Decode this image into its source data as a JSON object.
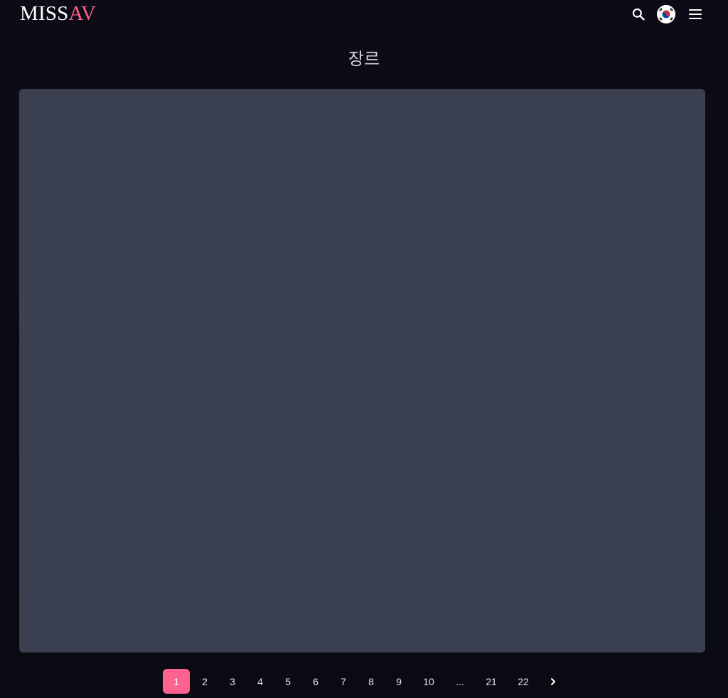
{
  "header": {
    "logo_main": "MISS",
    "logo_accent": "AV",
    "language": "Korean",
    "icons": {
      "search": "search-icon",
      "flag": "south-korea-flag-icon",
      "menu": "menu-icon"
    }
  },
  "page": {
    "title": "장르"
  },
  "pagination": {
    "pages": [
      "1",
      "2",
      "3",
      "4",
      "5",
      "6",
      "7",
      "8",
      "9",
      "10",
      "...",
      "21",
      "22"
    ],
    "active": "1",
    "next_icon": "chevron-right-icon"
  },
  "colors": {
    "accent": "#fe628e",
    "background": "#0b0a14",
    "placeholder": "#3b4051",
    "text": "#e5e7eb"
  }
}
